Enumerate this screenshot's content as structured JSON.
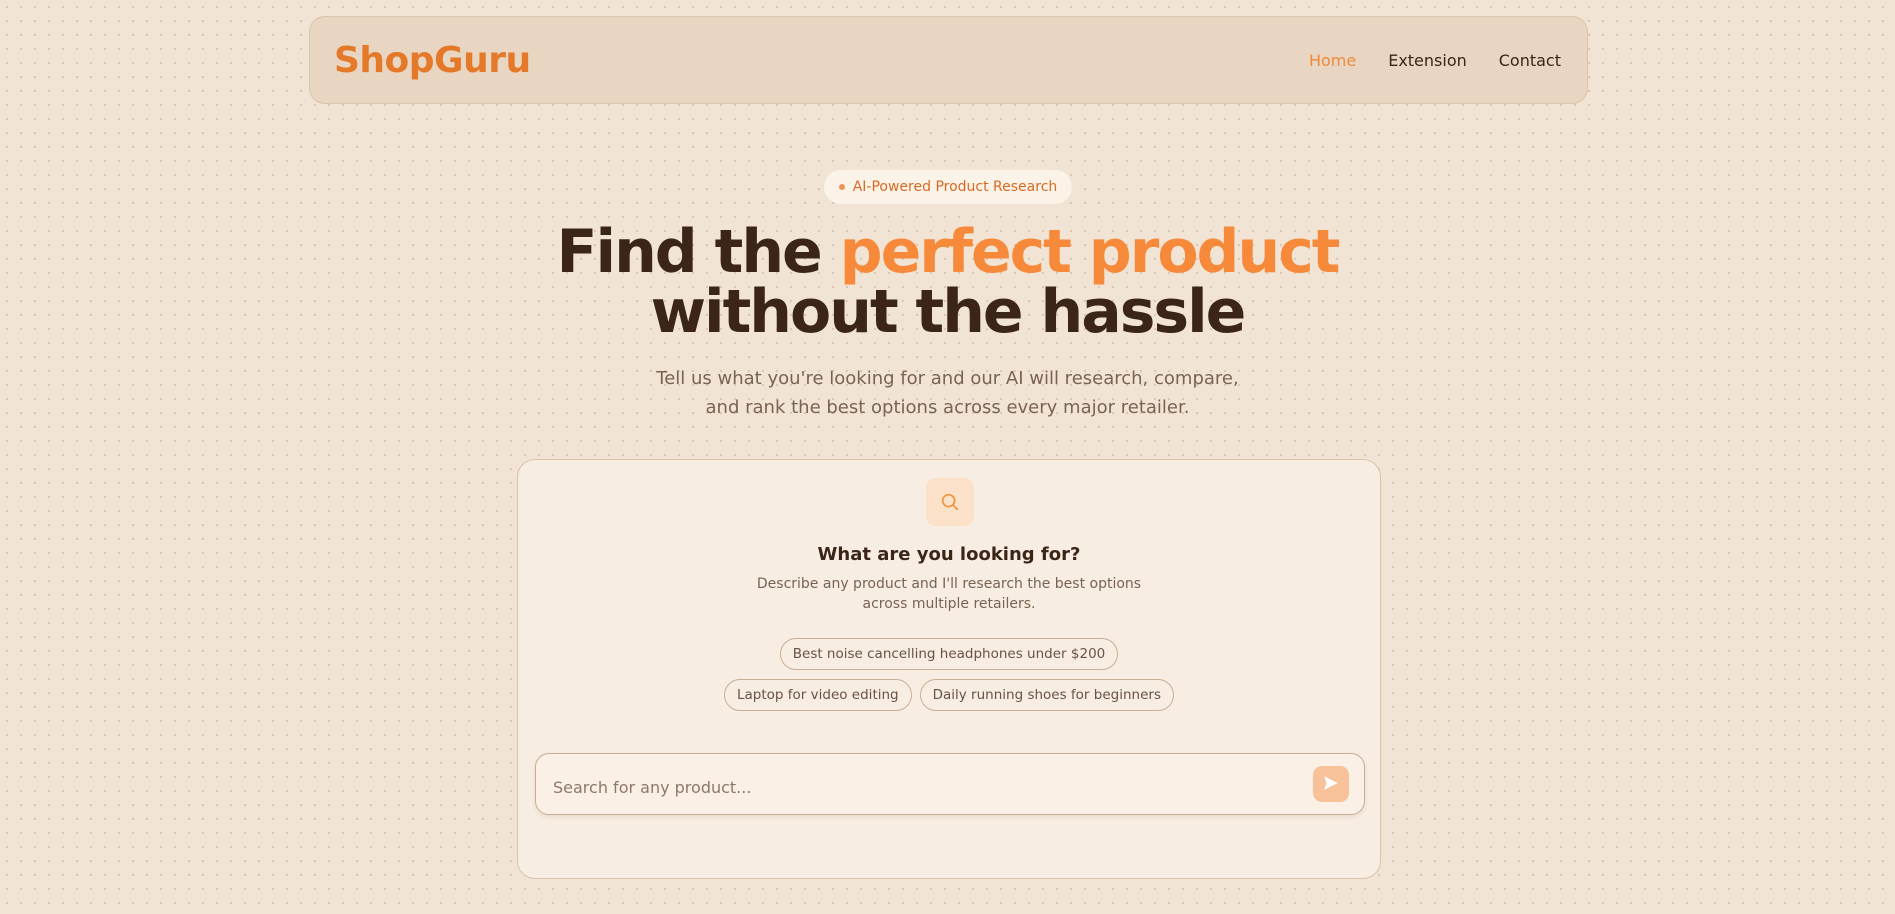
{
  "header": {
    "brand": "ShopGuru",
    "nav": [
      {
        "label": "Home",
        "active": true
      },
      {
        "label": "Extension",
        "active": false
      },
      {
        "label": "Contact",
        "active": false
      }
    ]
  },
  "hero": {
    "badge": "AI-Powered Product Research",
    "title_part1": "Find the ",
    "title_accent": "perfect product",
    "title_line2": "without the hassle",
    "subtitle_line1": "Tell us what you're looking for and our AI will research, compare,",
    "subtitle_line2": "and rank the best options across every major retailer."
  },
  "card": {
    "icon": "search-icon",
    "title": "What are you looking for?",
    "desc_line1": "Describe any product and I'll research the best options",
    "desc_line2": "across multiple retailers.",
    "suggestions": [
      "Best noise cancelling headphones under $200",
      "Laptop for video editing",
      "Daily running shoes for beginners"
    ]
  },
  "search": {
    "value": "",
    "placeholder": "Search for any product...",
    "send_icon": "send-icon"
  },
  "colors": {
    "accent": "#f7893a",
    "brand": "#e5792a",
    "text": "#3b2518",
    "background": "#f1e4d4"
  }
}
